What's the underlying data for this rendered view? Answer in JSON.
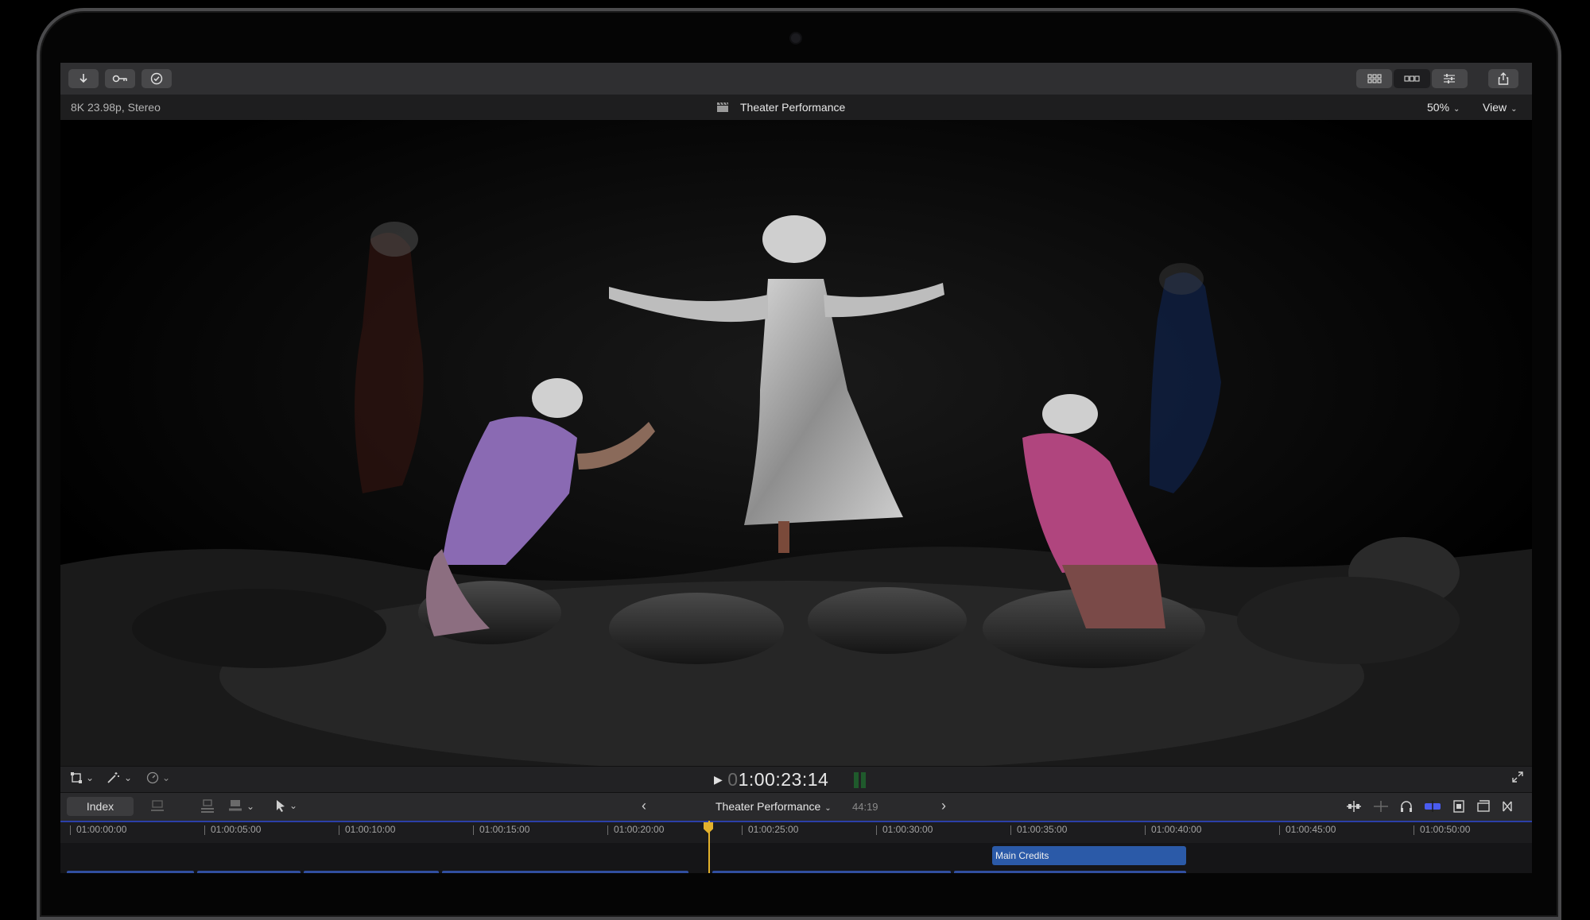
{
  "toolbar": {
    "left_buttons": [
      "import-icon",
      "keyword-icon",
      "checkmark-icon"
    ],
    "right_buttons": [
      "browser-grid-icon",
      "timeline-layout-icon",
      "inspector-sliders-icon",
      "share-icon"
    ]
  },
  "viewer": {
    "format": "8K 23.98p, Stereo",
    "project_title": "Theater Performance",
    "zoom": "50%",
    "view_menu": "View"
  },
  "transport": {
    "timecode_dim": "0",
    "timecode": "1:00:23:14"
  },
  "timeline": {
    "index_label": "Index",
    "project_name": "Theater Performance",
    "duration": "44:19",
    "ruler_ticks": [
      "01:00:00:00",
      "01:00:05:00",
      "01:00:10:00",
      "01:00:15:00",
      "01:00:20:00",
      "01:00:25:00",
      "01:00:30:00",
      "01:00:35:00",
      "01:00:40:00",
      "01:00:45:00",
      "01:00:50:00"
    ],
    "title_clip": "Main Credits"
  },
  "colors": {
    "playhead": "#e3b12c",
    "clip_blue": "#2b5aa8",
    "ruler_accent": "#2b3fa8"
  }
}
